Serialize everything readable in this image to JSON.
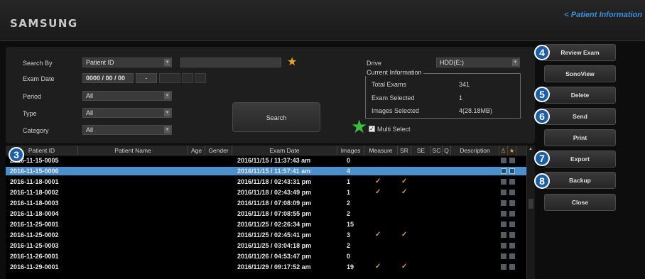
{
  "header": {
    "logo": "SAMSUNG",
    "breadcrumb": "< Patient Information"
  },
  "search": {
    "search_by_label": "Search By",
    "search_by_value": "Patient ID",
    "exam_date_label": "Exam Date",
    "exam_date_value": "0000 / 00 / 00",
    "exam_date_dash": "-",
    "period_label": "Period",
    "period_value": "All",
    "type_label": "Type",
    "type_value": "All",
    "category_label": "Category",
    "category_value": "All",
    "search_button": "Search",
    "drive_label": "Drive",
    "drive_value": "HDD(E:)"
  },
  "current_info": {
    "title": "Current Information",
    "total_exams_label": "Total Exams",
    "total_exams_value": "341",
    "exam_selected_label": "Exam Selected",
    "exam_selected_value": "1",
    "images_selected_label": "Images Selected",
    "images_selected_value": "4(28.18MB)"
  },
  "multi_select_label": "Multi Select",
  "table": {
    "columns": [
      "Patient ID",
      "Patient Name",
      "Age",
      "Gender",
      "Exam Date",
      "Images",
      "Measure",
      "SR",
      "SE",
      "SC",
      "Q",
      "Description"
    ],
    "rows": [
      {
        "id": "2016-11-15-0005",
        "date": "2016/11/15 / 11:37:43 am",
        "images": "0",
        "measure": false,
        "sr": false
      },
      {
        "id": "2016-11-15-0006",
        "date": "2016/11/15 / 11:57:41 am",
        "images": "4",
        "measure": false,
        "sr": false,
        "selected": true
      },
      {
        "id": "2016-11-18-0001",
        "date": "2016/11/18 / 02:43:31 pm",
        "images": "1",
        "measure": true,
        "sr": true
      },
      {
        "id": "2016-11-18-0002",
        "date": "2016/11/18 / 02:43:49 pm",
        "images": "1",
        "measure": true,
        "sr": true
      },
      {
        "id": "2016-11-18-0003",
        "date": "2016/11/18 / 07:08:09 pm",
        "images": "2",
        "measure": false,
        "sr": false
      },
      {
        "id": "2016-11-18-0004",
        "date": "2016/11/18 / 07:08:55 pm",
        "images": "2",
        "measure": false,
        "sr": false
      },
      {
        "id": "2016-11-25-0001",
        "date": "2016/11/25 / 02:26:34 pm",
        "images": "15",
        "measure": false,
        "sr": false
      },
      {
        "id": "2016-11-25-0002",
        "date": "2016/11/25 / 02:45:41 pm",
        "images": "3",
        "measure": true,
        "sr": true
      },
      {
        "id": "2016-11-25-0003",
        "date": "2016/11/25 / 03:04:18 pm",
        "images": "2",
        "measure": false,
        "sr": false
      },
      {
        "id": "2016-11-26-0001",
        "date": "2016/11/26 / 04:53:47 pm",
        "images": "0",
        "measure": false,
        "sr": false
      },
      {
        "id": "2016-11-29-0001",
        "date": "2016/11/29 / 09:17:52 am",
        "images": "19",
        "measure": true,
        "sr": true
      }
    ]
  },
  "sidebar": {
    "buttons": [
      "Review Exam",
      "SonoView",
      "Delete",
      "Send",
      "Print",
      "Export",
      "Backup",
      "Close"
    ]
  },
  "callouts": [
    "3",
    "4",
    "5",
    "6",
    "7",
    "8"
  ],
  "colors": {
    "selection": "#4a90cc",
    "accent": "#3a8fd9",
    "callout": "#1b5fa8",
    "marker_star": "#3bbf3b",
    "check": "#e09a2a"
  }
}
